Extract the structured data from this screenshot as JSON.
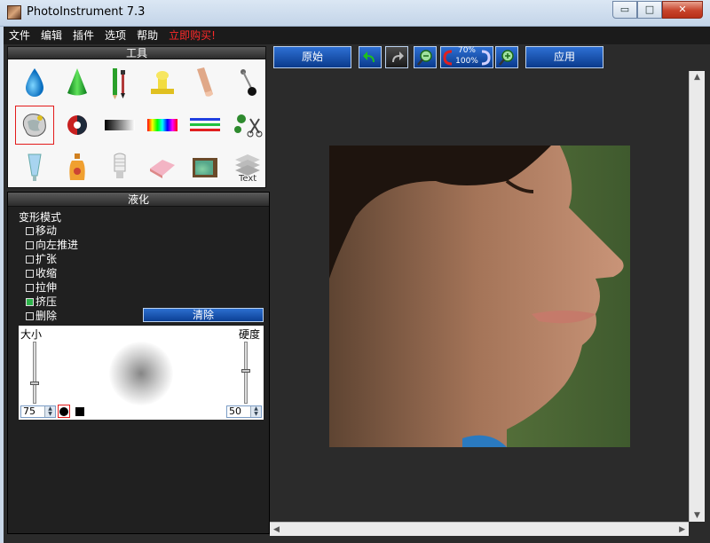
{
  "window": {
    "title": "PhotoInstrument 7.3",
    "min": "▭",
    "max": "□",
    "close": "✕"
  },
  "menu": [
    "文件",
    "编辑",
    "插件",
    "选项",
    "帮助",
    "立即购买!"
  ],
  "tools_panel": {
    "title": "工具",
    "items": [
      {
        "name": "drop-tool-icon"
      },
      {
        "name": "cone-tool-icon"
      },
      {
        "name": "pencil-brush-tool-icon"
      },
      {
        "name": "stamp-tool-icon"
      },
      {
        "name": "finger-tool-icon"
      },
      {
        "name": "pin-tool-icon"
      },
      {
        "name": "liquify-tool-icon"
      },
      {
        "name": "red-eye-tool-icon"
      },
      {
        "name": "gradient-tool-icon"
      },
      {
        "name": "color-spectrum-tool-icon"
      },
      {
        "name": "lines-tool-icon"
      },
      {
        "name": "clone-scissors-tool-icon"
      },
      {
        "name": "tube-tool-icon"
      },
      {
        "name": "bottle-tool-icon"
      },
      {
        "name": "bulb-tool-icon"
      },
      {
        "name": "eraser-tool-icon"
      },
      {
        "name": "tv-tool-icon"
      },
      {
        "name": "text-tool-icon"
      }
    ],
    "selected_index": 6,
    "text_tool_label": "Text"
  },
  "liquify": {
    "title": "液化",
    "mode_label": "变形模式",
    "options": [
      {
        "label": "移动",
        "checked": false
      },
      {
        "label": "向左推进",
        "checked": false
      },
      {
        "label": "扩张",
        "checked": false
      },
      {
        "label": "收缩",
        "checked": false
      },
      {
        "label": "拉伸",
        "checked": false
      },
      {
        "label": "挤压",
        "checked": true
      },
      {
        "label": "删除",
        "checked": false
      }
    ],
    "clear_label": "清除",
    "size_label": "大小",
    "hardness_label": "硬度",
    "size_value": "75",
    "hardness_value": "50"
  },
  "toolbar": {
    "original_label": "原始",
    "apply_label": "应用",
    "zoom_current": "70%",
    "zoom_full": "100%"
  },
  "colors": {
    "accent": "#0a3a8c",
    "panel_bg": "#202020",
    "selected_border": "#e31b1b"
  }
}
